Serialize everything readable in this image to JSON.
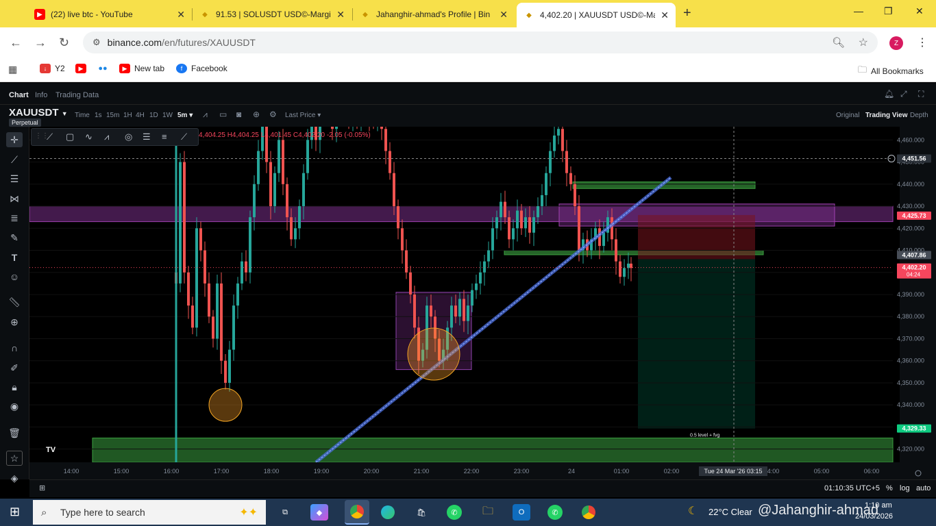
{
  "browser": {
    "tabs": [
      {
        "title": "(22) live btc - YouTube",
        "icon": "youtube-icon"
      },
      {
        "title": "91.53 | SOLUSDT USD©-Margin",
        "icon": "binance-icon"
      },
      {
        "title": "Jahanghir-ahmad's Profile | Bin",
        "icon": "binance-icon"
      },
      {
        "title": "4,402.20 | XAUUSDT USD©-Ma",
        "icon": "binance-icon"
      }
    ],
    "url_host": "binance.com",
    "url_path": "/en/futures/XAUUSDT",
    "profile_initial": "Z",
    "bookmarks": [
      {
        "label": "Y2",
        "icon": "download-icon"
      },
      {
        "label": "",
        "icon": "youtube-icon"
      },
      {
        "label": "",
        "icon": "chat-icon"
      },
      {
        "label": "New tab",
        "icon": "youtube-icon"
      },
      {
        "label": "Facebook",
        "icon": "facebook-icon"
      }
    ],
    "all_bookmarks": "All Bookmarks"
  },
  "app": {
    "tabs": [
      "Chart",
      "Info",
      "Trading Data"
    ],
    "symbol": "XAUUSDT",
    "contract": "Perpetual",
    "timeframes": [
      "Time",
      "1s",
      "15m",
      "1H",
      "4H",
      "1D",
      "1W",
      "5m"
    ],
    "price_type": "Last Price",
    "views": [
      "Original",
      "Trading View",
      "Depth"
    ],
    "ohlc": "4,404.25 H4,404.25 L4,401.45 C4,402.20 -2.05 (-0.05%)"
  },
  "chart_data": {
    "type": "candlestick",
    "symbol": "XAUUSDT",
    "interval": "5m",
    "x_ticks": [
      "14:00",
      "15:00",
      "16:00",
      "17:00",
      "18:00",
      "19:00",
      "20:00",
      "21:00",
      "22:00",
      "23:00",
      "24",
      "01:00",
      "02:00",
      "03:00",
      "04:00",
      "05:00",
      "06:00"
    ],
    "y_ticks": [
      4460,
      4450,
      4440,
      4430,
      4420,
      4410,
      4400,
      4390,
      4380,
      4370,
      4360,
      4350,
      4340,
      4330,
      4320
    ],
    "ylim": [
      4314,
      4466
    ],
    "price_labels": [
      {
        "value": "4,451.56",
        "role": "crosshair"
      },
      {
        "value": "4,425.73",
        "role": "stop"
      },
      {
        "value": "4,407.86",
        "role": "level"
      },
      {
        "value": "4,402.20",
        "role": "last",
        "countdown": "04:24"
      },
      {
        "value": "4,329.33",
        "role": "target"
      }
    ],
    "crosshair_time": "Tue 24 Mar '26   03:15",
    "annotation": "0.5 level + fvg",
    "zones": [
      {
        "kind": "supply",
        "color": "#7a2f8a",
        "low": 4423,
        "high": 4430
      },
      {
        "kind": "demand",
        "color": "#2e7d32",
        "low": 4314,
        "high": 4325
      },
      {
        "kind": "level",
        "color": "#2e7d32",
        "low": 4408,
        "high": 4410
      },
      {
        "kind": "level",
        "color": "#2e7d32",
        "low": 4438,
        "high": 4441
      }
    ],
    "colors": {
      "up": "#26a69a",
      "down": "#ef5350",
      "bg": "#000000"
    }
  },
  "status": {
    "clock": "01:10:35 UTC+5",
    "percent": "%",
    "log": "log",
    "auto": "auto"
  },
  "taskbar": {
    "search_placeholder": "Type here to search",
    "weather": "22°C  Clear",
    "watermark": "@Jahanghir-ahmad",
    "time": "1:10 am",
    "date": "24/03/2026"
  }
}
